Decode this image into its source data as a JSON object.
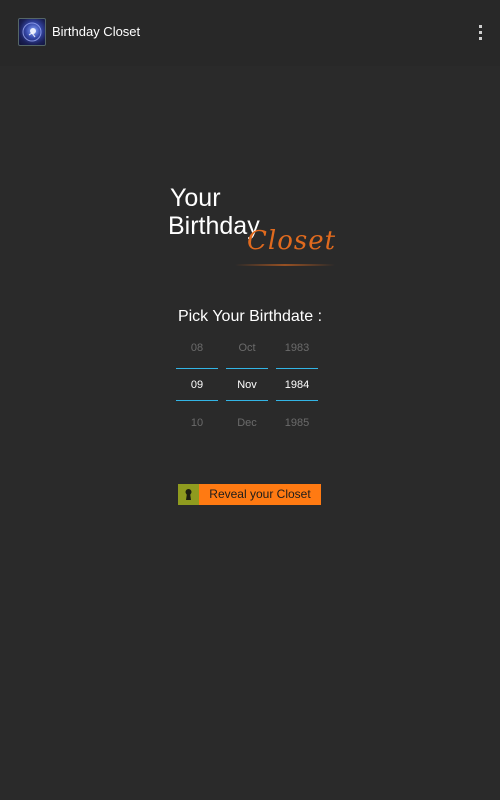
{
  "app": {
    "title": "Birthday Closet",
    "icon": "app-logo-icon",
    "overflow_icon": "overflow-menu-icon"
  },
  "logo": {
    "line1": "Your",
    "line2": "Birthday",
    "line3": "Closet",
    "accent_color": "#e06a1e"
  },
  "picker": {
    "label": "Pick Your Birthdate :",
    "divider_color": "#33b5e5",
    "day": {
      "prev": "08",
      "value": "09",
      "next": "10"
    },
    "month": {
      "prev": "Oct",
      "value": "Nov",
      "next": "Dec"
    },
    "year": {
      "prev": "1983",
      "value": "1984",
      "next": "1985"
    }
  },
  "reveal_button": {
    "label": "Reveal your Closet",
    "icon": "keyhole-icon",
    "color": "#ff7a12",
    "icon_bg_color": "#8f9b1f"
  }
}
